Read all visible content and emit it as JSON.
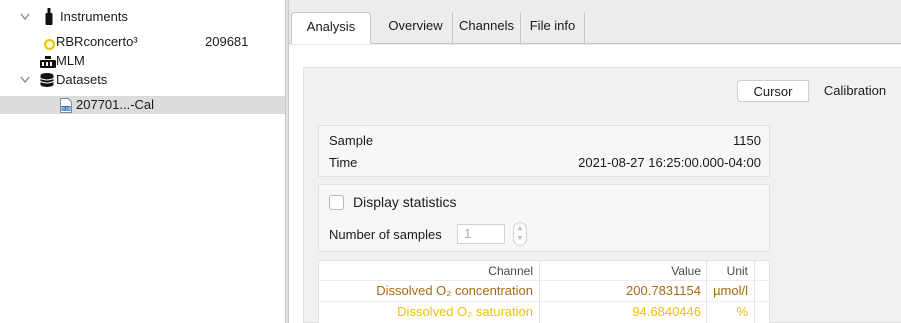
{
  "tree": {
    "instruments_label": "Instruments",
    "instrument_name": "RBRconcerto³",
    "instrument_serial": "209681",
    "mlm_label": "MLM",
    "datasets_label": "Datasets",
    "dataset_item": "207701...-Cal"
  },
  "tabs": {
    "analysis": "Analysis",
    "overview": "Overview",
    "channels": "Channels",
    "file_info": "File info"
  },
  "subtabs": {
    "cursor": "Cursor",
    "calibration": "Calibration"
  },
  "info": {
    "sample_label": "Sample",
    "sample_value": "1150",
    "time_label": "Time",
    "time_value": "2021-08-27 16:25:00.000-04:00"
  },
  "stats": {
    "display_label": "Display statistics",
    "display_checked": false,
    "samples_label": "Number of samples",
    "samples_value": "1"
  },
  "table": {
    "headers": {
      "channel": "Channel",
      "value": "Value",
      "unit": "Unit"
    },
    "rows": [
      {
        "channel": "Dissolved O₂ concentration",
        "value": "200.7831154",
        "unit": "µmol/l",
        "color": "#a86a10"
      },
      {
        "channel": "Dissolved O₂ saturation",
        "value": "94.6840446",
        "unit": "%",
        "color": "#f0c010"
      }
    ]
  },
  "colors": {
    "instrument_dot": "#e6c600"
  },
  "icons": {
    "instruments": "instrument-probe-icon",
    "mlm": "mlm-device-icon",
    "datasets": "database-icon",
    "dataset_file": "binary-file-icon"
  }
}
